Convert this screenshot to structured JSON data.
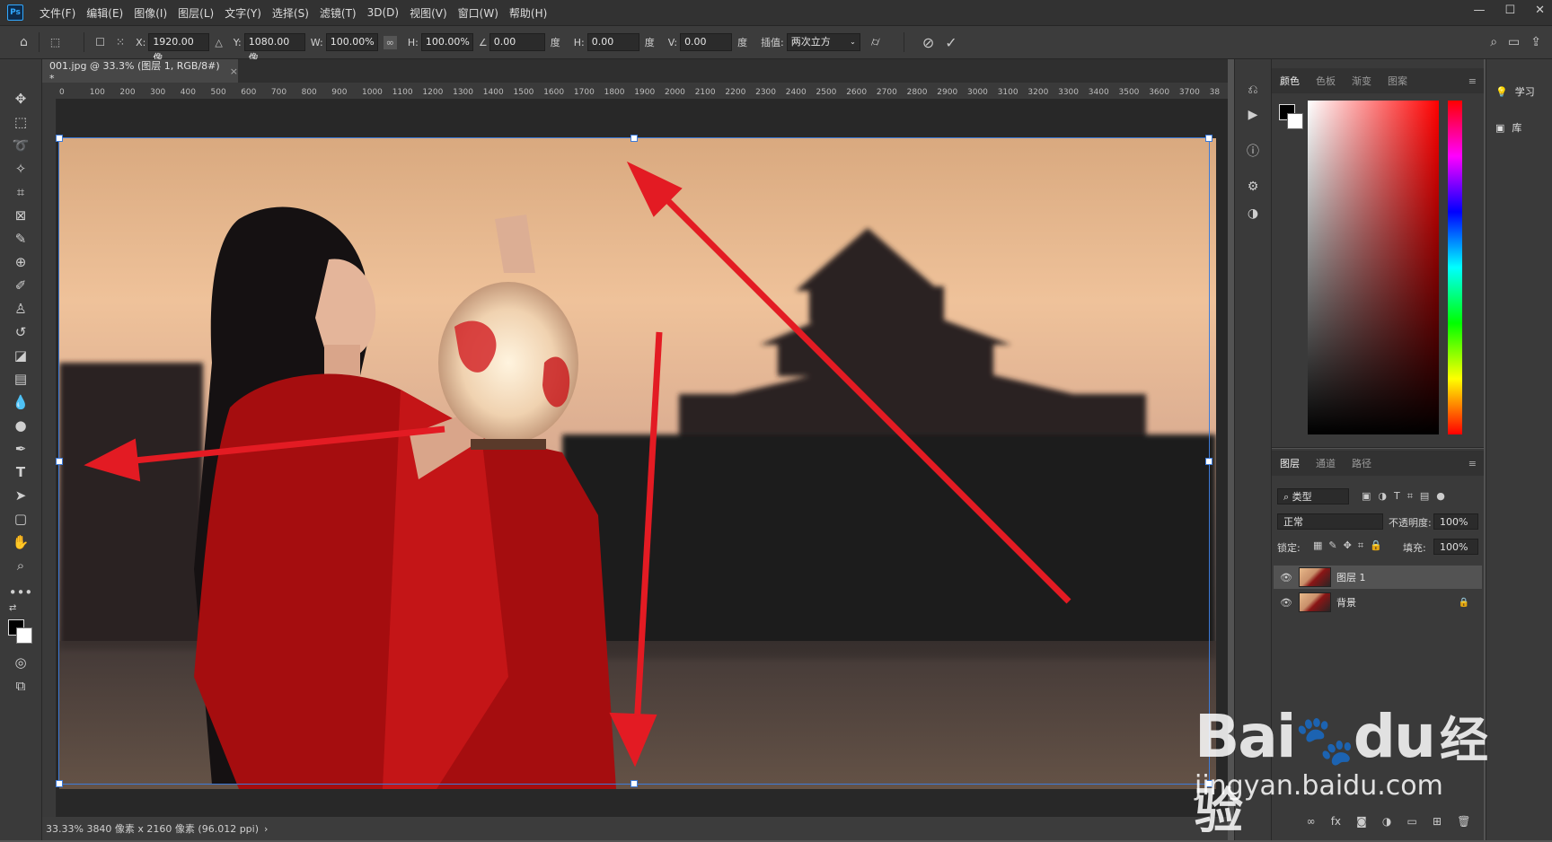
{
  "menubar": {
    "items": [
      "文件(F)",
      "编辑(E)",
      "图像(I)",
      "图层(L)",
      "文字(Y)",
      "选择(S)",
      "滤镜(T)",
      "3D(D)",
      "视图(V)",
      "窗口(W)",
      "帮助(H)"
    ],
    "logo": "Ps"
  },
  "options": {
    "x_label": "X:",
    "x_value": "1920.00 像",
    "y_label": "Y:",
    "y_value": "1080.00 像",
    "w_label": "W:",
    "w_value": "100.00%",
    "h_label": "H:",
    "h_value": "100.00%",
    "angle_value": "0.00",
    "deg1": "度",
    "hskew_label": "H:",
    "hskew_value": "0.00",
    "deg2": "度",
    "vskew_label": "V:",
    "vskew_value": "0.00",
    "deg3": "度",
    "interp_label": "插值:",
    "interp_value": "两次立方"
  },
  "document": {
    "tab_title": "001.jpg @ 33.3% (图层 1, RGB/8#) *",
    "close": "×",
    "ruler_h": [
      "0",
      "100",
      "200",
      "300",
      "400",
      "500",
      "600",
      "700",
      "800",
      "900",
      "1000",
      "1100",
      "1200",
      "1300",
      "1400",
      "1500",
      "1600",
      "1700",
      "1800",
      "1900",
      "2000",
      "2100",
      "2200",
      "2300",
      "2400",
      "2500",
      "2600",
      "2700",
      "2800",
      "2900",
      "3000",
      "3100",
      "3200",
      "3300",
      "3400",
      "3500",
      "3600",
      "3700",
      "38"
    ],
    "status": "33.33%   3840 像素 x 2160 像素 (96.012 ppi)"
  },
  "colorpanel": {
    "tabs": [
      "颜色",
      "色板",
      "渐变",
      "图案"
    ]
  },
  "layerspanel": {
    "tabs": [
      "图层",
      "通道",
      "路径"
    ],
    "filter": "类型",
    "blend_mode": "正常",
    "opacity_label": "不透明度:",
    "opacity_value": "100%",
    "lock_label": "锁定:",
    "fill_label": "填充:",
    "fill_value": "100%",
    "layers": [
      {
        "name": "图层 1",
        "selected": true
      },
      {
        "name": "背景",
        "selected": false,
        "locked": true
      }
    ]
  },
  "learnpanel": {
    "items": [
      "学习",
      "库"
    ]
  },
  "watermark": {
    "brand_a": "Bai",
    "brand_b": "du",
    "brand_cn": "经验",
    "url": "jingyan.baidu.com"
  },
  "colors": {
    "arrow": "#e31b23",
    "selection": "#3d7bd9"
  }
}
